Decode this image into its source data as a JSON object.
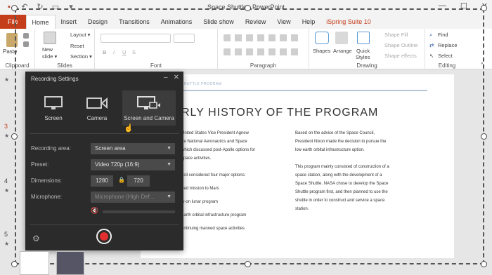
{
  "window": {
    "title": "Space Shuttle - PowerPoint",
    "minimize": "—",
    "maximize": "☐",
    "close": "✕"
  },
  "tabs": [
    "File",
    "Home",
    "Insert",
    "Design",
    "Transitions",
    "Animations",
    "Slide show",
    "Review",
    "View",
    "Help",
    "iSpring Suite 10"
  ],
  "ribbon": {
    "clipboard": {
      "label": "Clipboard",
      "paste": "Paste"
    },
    "slides": {
      "label": "Slides",
      "new_slide": "New",
      "new_slide_2": "slide ▾",
      "layout": "Layout ▾",
      "reset": "Reset",
      "section": "Section ▾"
    },
    "font": {
      "label": "Font"
    },
    "paragraph": {
      "label": "Paragraph"
    },
    "drawing": {
      "label": "Drawing",
      "shapes": "Shapes",
      "arrange": "Arrange",
      "quick_styles": "Quick",
      "quick_styles_2": "Styles",
      "shape_fill": "Shape Fill",
      "shape_outline": "Shape Outline",
      "shape_effects": "Shape effects"
    },
    "editing": {
      "label": "Editing",
      "find": "Find",
      "replace": "Replace",
      "select": "Select"
    }
  },
  "thumbs": {
    "n3": "3",
    "n4": "4",
    "n5": "5",
    "star": "★"
  },
  "slide": {
    "header": "SHUTTLE PROGRAM",
    "title": "RLY HISTORY OF THE PROGRAM",
    "left_col": [
      "United States Vice President Agnew",
      "he National Aeronautics and Space",
      "which discussed post-Apollo options for",
      "space activities.",
      "",
      "ncil considered four major options:",
      "",
      "ned mission to Mars",
      "",
      "w-on lunar program",
      "",
      "earth orbital infrastructure program",
      "",
      "ontinuing manned space activities"
    ],
    "right_col": [
      "Based on the advice of the Space Council,",
      "President Nixon made the decision to pursue the",
      "low earth orbital infrastructure option.",
      "",
      "This program mainly consisted of construction of a",
      "space station, along with the development of a",
      "Space Shuttle. NASA chose to develop the Space",
      "Shuttle program first, and then planned to use the",
      "shuttle in order to construct and service a space",
      "station."
    ]
  },
  "dialog": {
    "title": "Recording Settings",
    "modes": [
      "Screen",
      "Camera",
      "Screen and Camera"
    ],
    "recording_area_label": "Recording area:",
    "recording_area_value": "Screen area",
    "preset_label": "Preset:",
    "preset_value": "Video 720p (16:9)",
    "dimensions_label": "Dimensions:",
    "width": "1280",
    "height": "720",
    "microphone_label": "Microphone:",
    "microphone_value": "Microphone (High Def..."
  },
  "colors": {
    "accent": "#c43e1c",
    "record": "#e02f2f",
    "dialog_bg": "#2b2b2b"
  }
}
